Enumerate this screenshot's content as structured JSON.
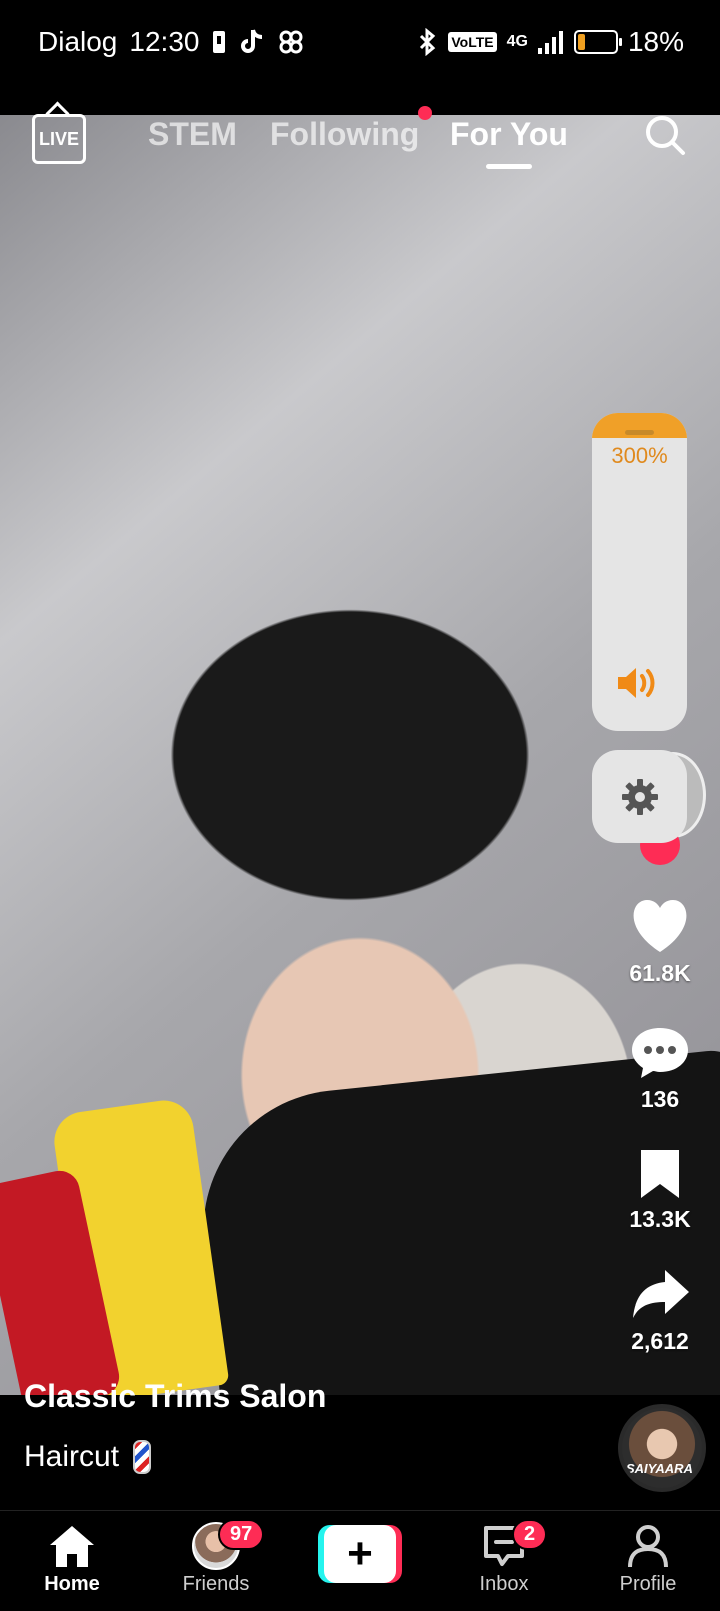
{
  "status_bar": {
    "carrier": "Dialog",
    "time": "12:30",
    "network": "4G",
    "volte": "VoLTE",
    "battery": "18%"
  },
  "top_nav": {
    "live_label": "LIVE",
    "tabs": [
      {
        "label": "STEM",
        "active": false
      },
      {
        "label": "Following",
        "active": false,
        "has_dot": true
      },
      {
        "label": "For You",
        "active": true
      }
    ]
  },
  "volume": {
    "label": "300%",
    "level_fraction": 0.08
  },
  "actions": {
    "likes": "61.8K",
    "comments": "136",
    "saves": "13.3K",
    "shares": "2,612"
  },
  "caption": {
    "author": "Classic Trims Salon",
    "text": "Haircut"
  },
  "music": {
    "disc_text": "SAIYAARA"
  },
  "bottom_nav": {
    "home": "Home",
    "friends": "Friends",
    "friends_badge": "97",
    "inbox": "Inbox",
    "inbox_badge": "2",
    "profile": "Profile"
  },
  "colors": {
    "accent": "#fe2c55",
    "cyan": "#25f4ee",
    "volume_orange": "#f0a028"
  }
}
